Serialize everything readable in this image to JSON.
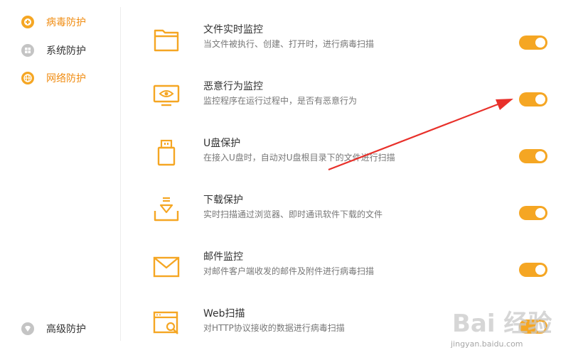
{
  "sidebar": {
    "items": [
      {
        "label": "病毒防护",
        "icon": "plus-circle-icon",
        "active": true
      },
      {
        "label": "系统防护",
        "icon": "windows-icon",
        "active": false
      },
      {
        "label": "网络防护",
        "icon": "globe-icon",
        "active": true
      }
    ],
    "bottom_item": {
      "label": "高级防护",
      "icon": "diamond-icon"
    }
  },
  "settings": [
    {
      "title": "文件实时监控",
      "desc": "当文件被执行、创建、打开时，进行病毒扫描",
      "icon": "folder-icon",
      "enabled": true
    },
    {
      "title": "恶意行为监控",
      "desc": "监控程序在运行过程中，是否有恶意行为",
      "icon": "monitor-eye-icon",
      "enabled": true
    },
    {
      "title": "U盘保护",
      "desc": "在接入U盘时，自动对U盘根目录下的文件进行扫描",
      "icon": "usb-drive-icon",
      "enabled": true
    },
    {
      "title": "下载保护",
      "desc": "实时扫描通过浏览器、即时通讯软件下载的文件",
      "icon": "download-tray-icon",
      "enabled": true
    },
    {
      "title": "邮件监控",
      "desc": "对邮件客户端收发的邮件及附件进行病毒扫描",
      "icon": "envelope-icon",
      "enabled": true
    },
    {
      "title": "Web扫描",
      "desc": "对HTTP协议接收的数据进行病毒扫描",
      "icon": "web-scan-icon",
      "enabled": true
    }
  ],
  "colors": {
    "accent": "#f5a623",
    "active_text": "#f08c12",
    "arrow": "#e8302a"
  },
  "watermark": {
    "main": "Bai 经验",
    "sub": "jingyan.baidu.com"
  }
}
